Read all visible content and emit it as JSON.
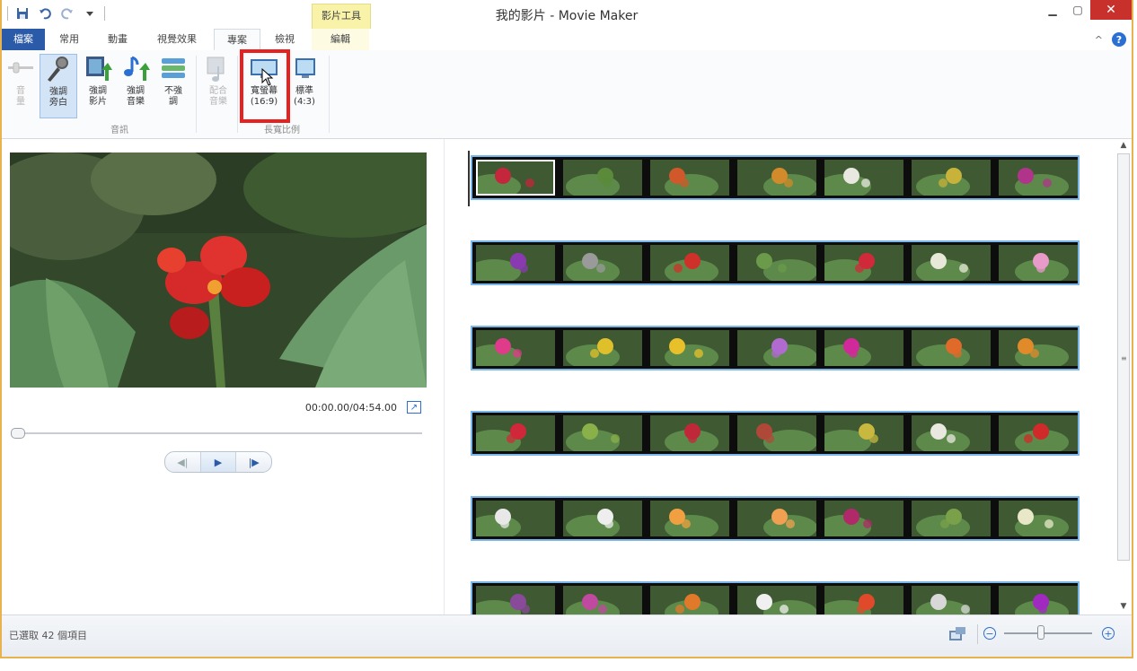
{
  "window": {
    "title": "我的影片 - Movie Maker",
    "contextual_tab_header": "影片工具",
    "controls": {
      "minimize": "▁",
      "maximize": "▢",
      "close": "✕"
    }
  },
  "quick_access": {
    "icons": [
      "save-icon",
      "undo-icon",
      "redo-icon",
      "customize-dropdown-icon"
    ]
  },
  "tabs": [
    {
      "label": "檔案"
    },
    {
      "label": "常用"
    },
    {
      "label": "動畫"
    },
    {
      "label": "視覺效果"
    },
    {
      "label": "專案"
    },
    {
      "label": "檢視"
    },
    {
      "label": "編輯"
    }
  ],
  "ribbon": {
    "buttons": [
      {
        "label": "音\n量",
        "state": "disabled"
      },
      {
        "label": "強調\n旁白",
        "state": "selected"
      },
      {
        "label": "強調\n影片",
        "state": "normal"
      },
      {
        "label": "強調\n音樂",
        "state": "normal"
      },
      {
        "label": "不強\n調",
        "state": "normal"
      },
      {
        "label": "配合\n音樂",
        "state": "disabled"
      },
      {
        "label": "寬螢幕\n(16:9)",
        "state": "normal"
      },
      {
        "label": "標準\n(4:3)",
        "state": "normal"
      }
    ],
    "groups": [
      {
        "label": "音訊"
      },
      {
        "label": "長寬比例"
      }
    ]
  },
  "preview": {
    "timecode": "00:00.00/04:54.00",
    "seek_fraction": 0.0,
    "controls": {
      "prev": "◀|",
      "play": "▶",
      "next": "|▶"
    }
  },
  "storyboard": {
    "rows": [
      [
        {
          "c": "#c4263b"
        },
        {
          "c": "#5a8a3a"
        },
        {
          "c": "#d0582a"
        },
        {
          "c": "#d28a2a"
        },
        {
          "c": "#e8e8e0"
        },
        {
          "c": "#c8b23a"
        },
        {
          "c": "#b0358a"
        }
      ],
      [
        {
          "c": "#8a3ab0"
        },
        {
          "c": "#9a9a9a"
        },
        {
          "c": "#d0302a"
        },
        {
          "c": "#6a9a4a"
        },
        {
          "c": "#d02a3a"
        },
        {
          "c": "#e8e8d8"
        },
        {
          "c": "#e89ac8"
        }
      ],
      [
        {
          "c": "#e03a8a"
        },
        {
          "c": "#e0c02a"
        },
        {
          "c": "#e8c02a"
        },
        {
          "c": "#b06ad0"
        },
        {
          "c": "#d02a9a"
        },
        {
          "c": "#e06a2a"
        },
        {
          "c": "#e08a2a"
        }
      ],
      [
        {
          "c": "#d0283a"
        },
        {
          "c": "#8ab04a"
        },
        {
          "c": "#c0283a"
        },
        {
          "c": "#b0483a"
        },
        {
          "c": "#c8b840"
        },
        {
          "c": "#e8e8e0"
        },
        {
          "c": "#d02a2a"
        }
      ],
      [
        {
          "c": "#e8e8e8"
        },
        {
          "c": "#eeeeee"
        },
        {
          "c": "#f0a040"
        },
        {
          "c": "#f0a050"
        },
        {
          "c": "#b02a6a"
        },
        {
          "c": "#7aa04a"
        },
        {
          "c": "#e8e8c8"
        }
      ],
      [
        {
          "c": "#8a4a9a"
        },
        {
          "c": "#c04aa0"
        },
        {
          "c": "#e07a2a"
        },
        {
          "c": "#f0f0f0"
        },
        {
          "c": "#e04a2a"
        },
        {
          "c": "#d8d8d8"
        },
        {
          "c": "#a02ac0"
        }
      ]
    ]
  },
  "status": {
    "text": "已選取 42 個項目",
    "zoom_fraction": 0.42
  }
}
